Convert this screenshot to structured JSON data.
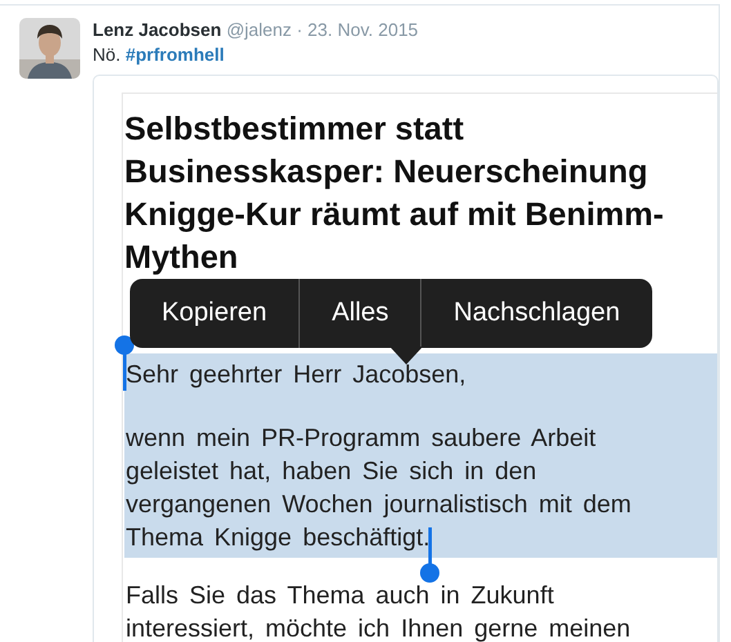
{
  "tweet": {
    "author": "Lenz Jacobsen",
    "handle": "@jalenz",
    "date": "· 23. Nov. 2015",
    "text": "Nö.",
    "hashtag": "#prfromhell"
  },
  "article": {
    "headline": "Selbstbestimmer statt Businesskasper: Neuerscheinung Knigge-Kur räumt auf mit Benimm-Mythen",
    "paragraphs": [
      {
        "text": "Sehr geehrter Herr Jacobsen,",
        "selected": true
      },
      {
        "text": "wenn mein PR-Programm saubere Arbeit geleistet hat, haben Sie sich in den vergangenen Wochen journalistisch mit dem Thema Knigge beschäftigt.",
        "selected": true
      },
      {
        "text": "Falls Sie das Thema auch in Zukunft interessiert, möchte ich Ihnen gerne meinen",
        "selected": false
      }
    ]
  },
  "edit_menu": {
    "items": [
      "Kopieren",
      "Alles",
      "Nachschlagen"
    ]
  }
}
